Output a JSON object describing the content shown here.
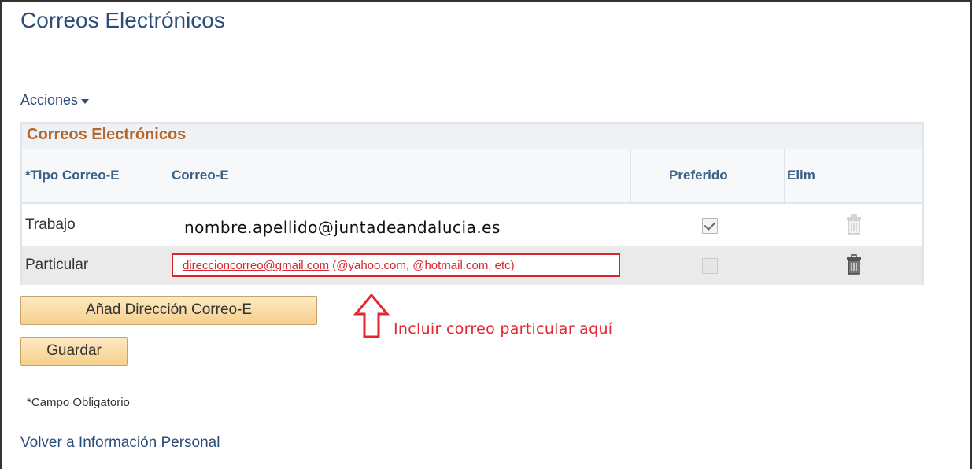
{
  "page": {
    "title": "Correos Electrónicos",
    "actions_label": "Acciones"
  },
  "grid": {
    "title": "Correos Electrónicos",
    "columns": {
      "type": "*Tipo Correo-E",
      "email": "Correo-E",
      "preferred": "Preferido",
      "delete": "Elim"
    },
    "rows": [
      {
        "type": "Trabajo",
        "email": "nombre.apellido@juntadeandalucia.es",
        "preferred": true,
        "delete_enabled": false
      },
      {
        "type": "Particular",
        "email_value": "direccioncorreo@gmail.com",
        "email_hint": " (@yahoo.com, @hotmail.com, etc)",
        "preferred": false,
        "delete_enabled": true
      }
    ]
  },
  "buttons": {
    "add_email": "Añad Dirección Correo-E",
    "save": "Guardar"
  },
  "annotation": {
    "text": "Incluir correo particular aquí",
    "color": "#e3262f"
  },
  "footer": {
    "required_note": "*Campo Obligatorio",
    "back_link": "Volver a Información Personal"
  },
  "colors": {
    "link": "#2a4d7a",
    "grid_title": "#b5662a",
    "button": "#f6d08c",
    "highlight_border": "#d7262e"
  }
}
